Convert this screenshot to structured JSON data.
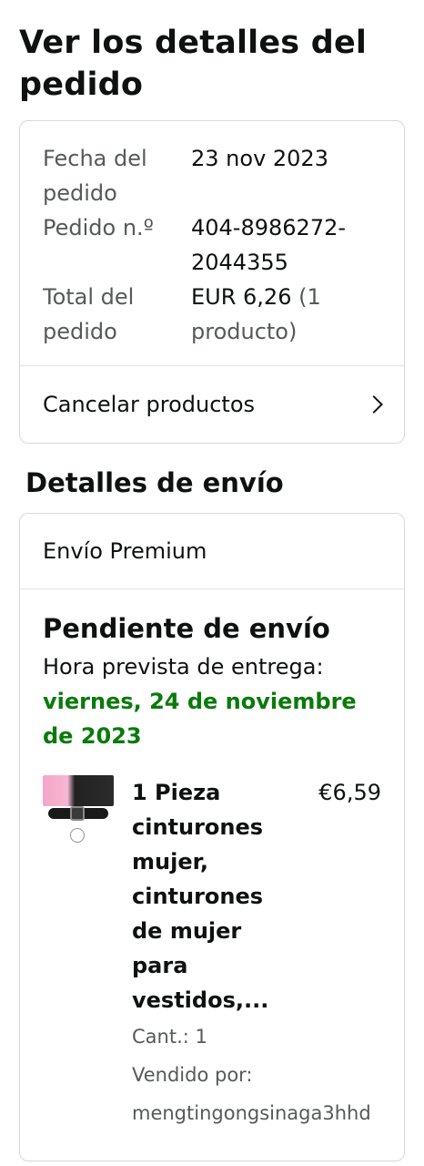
{
  "page_title": "Ver los detalles del pedido",
  "order": {
    "date_label": "Fecha del pedido",
    "date_value": "23 nov 2023",
    "number_label": "Pedido n.º",
    "number_value": "404-8986272-2044355",
    "total_label": "Total del pedido",
    "total_value": "EUR 6,26",
    "total_count": "(1 producto)",
    "cancel_label": "Cancelar productos"
  },
  "shipping": {
    "section_title": "Detalles de envío",
    "method": "Envío Premium",
    "status": "Pendiente de envío",
    "eta_label": "Hora prevista de entrega:",
    "eta_date": "viernes, 24 de noviembre de 2023"
  },
  "item": {
    "title": "1 Pieza cinturones mujer, cinturones de mujer para vestidos,...",
    "price": "€6,59",
    "quantity": "Cant.: 1",
    "sold_by_label": "Vendido por:",
    "seller": "mengtingongsinaga3hhd"
  },
  "colors": {
    "eta_green": "#0a7a0a",
    "border": "#d5d9d9",
    "muted_text": "#565959"
  },
  "icons": {
    "cancel_chevron": "chevron-right-icon"
  }
}
